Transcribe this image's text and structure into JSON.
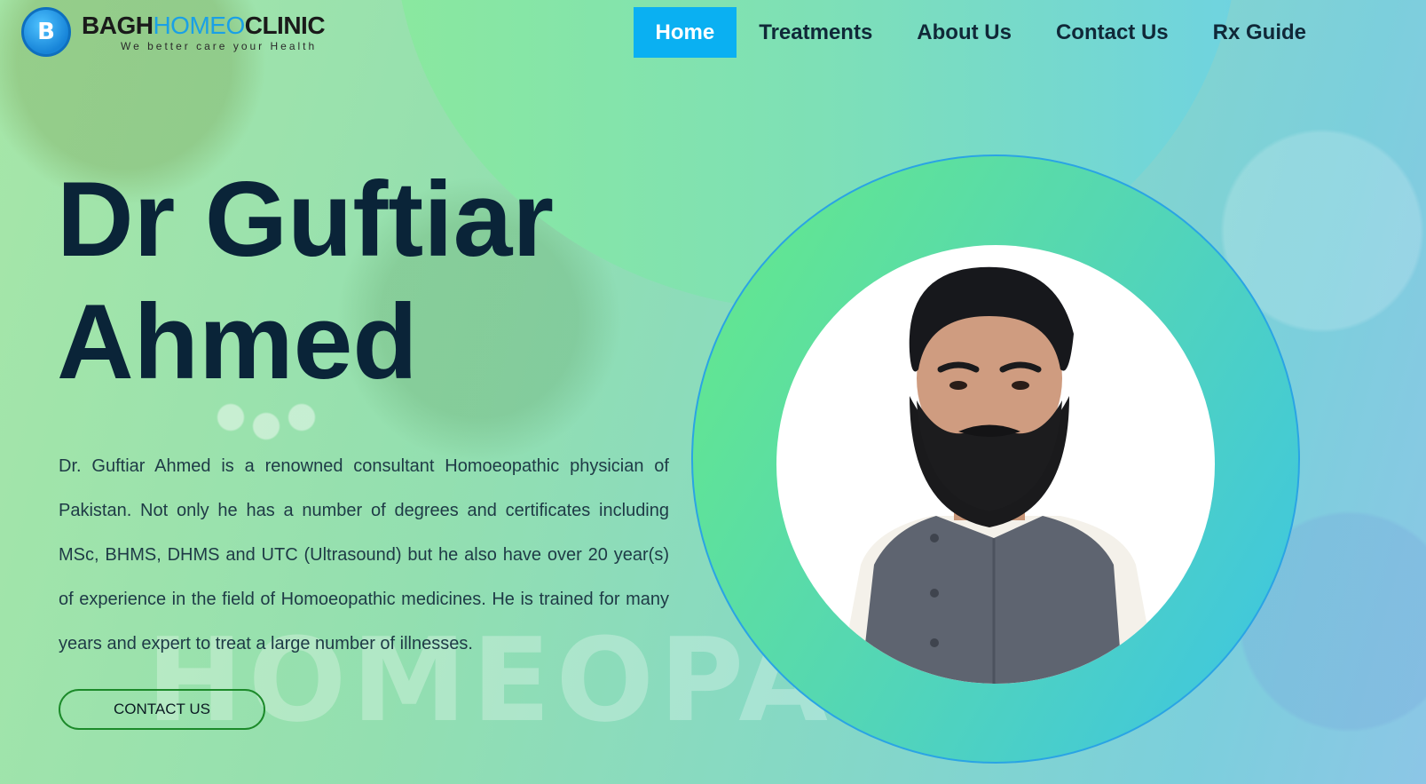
{
  "brand": {
    "badge": "B",
    "name_part1": "BAGH",
    "name_part2": "HOMEO",
    "name_part3": "CLINIC",
    "tagline": "We better care your Health"
  },
  "nav": {
    "items": [
      {
        "label": "Home",
        "active": true
      },
      {
        "label": "Treatments",
        "active": false
      },
      {
        "label": "About Us",
        "active": false
      },
      {
        "label": "Contact Us",
        "active": false
      },
      {
        "label": "Rx Guide",
        "active": false
      }
    ]
  },
  "hero": {
    "title_line1": "Dr Guftiar",
    "title_line2": "Ahmed",
    "description": "Dr. Guftiar Ahmed is a renowned consultant Homoeopathic physician of Pakistan. Not only he has a number of degrees and certificates including MSc, BHMS, DHMS and UTC (Ultrasound) but he also have over 20 year(s) of experience in the field of Homoeopathic medicines. He is trained for many years and expert to treat a large number of illnesses.",
    "cta_label": "CONTACT US",
    "background_word": "HOMEOPATHY"
  },
  "colors": {
    "accent": "#0ab0f2",
    "title": "#0a2438",
    "button_border": "#1c8a2a"
  }
}
